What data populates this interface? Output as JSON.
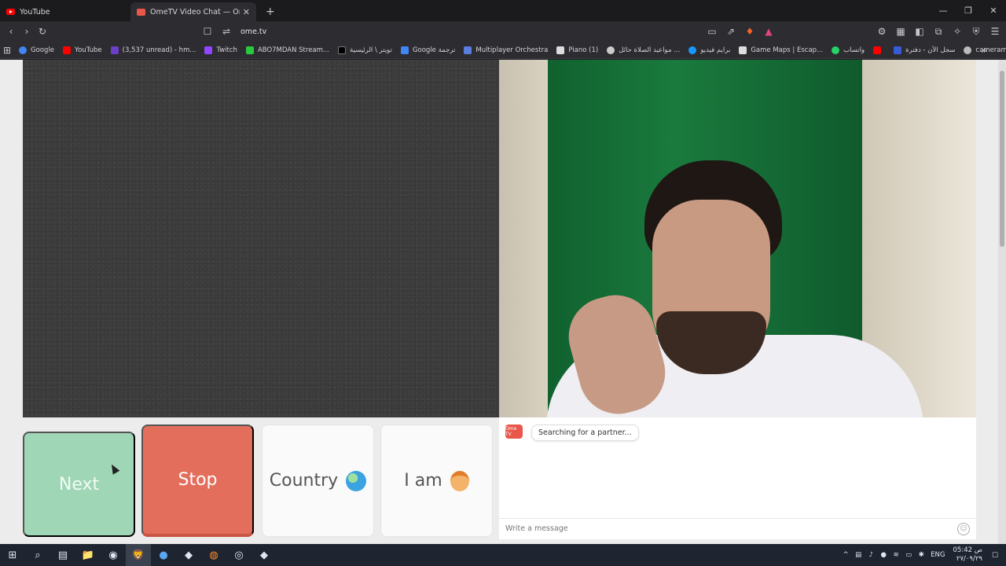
{
  "tabs": [
    {
      "title": "YouTube",
      "favicon_color": "#ff0000",
      "active": false
    },
    {
      "title": "OmeTV Video Chat — Omeg",
      "favicon_color": "#e8574a",
      "active": true
    }
  ],
  "window_controls": {
    "minimize": "—",
    "restore": "❐",
    "close": "✕"
  },
  "toolbar": {
    "back": "‹",
    "forward": "›",
    "reload": "↻",
    "bookmark": "☐",
    "site_info": "⇌",
    "url": "ome.tv",
    "right_icons": [
      "▭",
      "⇗",
      "♦",
      "▲",
      "⚙",
      "▦",
      "◧",
      "⧉",
      "✧",
      "⛨",
      "☰"
    ]
  },
  "bookmarks": [
    {
      "label": "Google",
      "color": "#4285f4"
    },
    {
      "label": "YouTube",
      "color": "#ff0000"
    },
    {
      "label": "(3,537 unread) - hm...",
      "color": "#6b3fc7"
    },
    {
      "label": "Twitch",
      "color": "#9146ff"
    },
    {
      "label": "ABO7MDAN Stream...",
      "color": "#27c93f"
    },
    {
      "label": "تويتر \\ الرئيسية",
      "color": "#000000"
    },
    {
      "label": "Google ترجمة",
      "color": "#4285f4"
    },
    {
      "label": "Multiplayer Orchestra",
      "color": "#5a7de0"
    },
    {
      "label": "Piano (1)",
      "color": "#dddddd"
    },
    {
      "label": "مواعيد الصلاة حائل ...",
      "color": "#cccccc"
    },
    {
      "label": "برايم فيديو",
      "color": "#1a98ff"
    },
    {
      "label": "Game Maps | Escap...",
      "color": "#dddddd"
    },
    {
      "label": "واتساب",
      "color": "#25d366"
    },
    {
      "label": "",
      "color": "#ff0000"
    },
    {
      "label": "سجل الآن - دفترة",
      "color": "#3a5bd9"
    },
    {
      "label": "cameraman using tv...",
      "color": "#bbbbbb"
    }
  ],
  "controls": {
    "next": "Next",
    "stop": "Stop",
    "country": "Country",
    "iam": "I am"
  },
  "chat": {
    "logo_text": "Ome TV",
    "status": "Searching for a partner...",
    "input_placeholder": "Write a message"
  },
  "taskbar": {
    "icons": [
      "⊞",
      "⌕",
      "▤",
      "📁",
      "◉",
      "🦁",
      "●",
      "◆",
      "◍",
      "◎",
      "◆"
    ],
    "tray": {
      "lang": "ENG",
      "time": "05:42 ص",
      "date": "٢٧/٠٩/٢٩"
    }
  }
}
